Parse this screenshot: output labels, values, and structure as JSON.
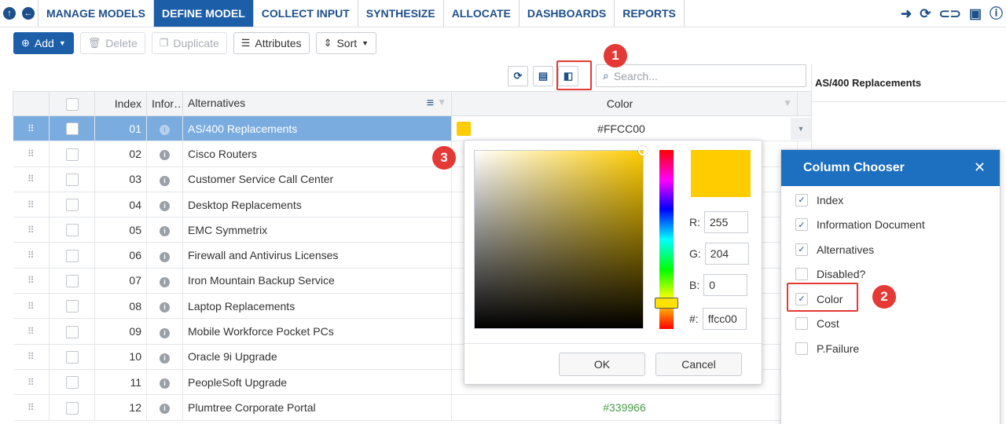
{
  "nav": {
    "tabs": [
      {
        "label": "MANAGE MODELS",
        "active": false
      },
      {
        "label": "DEFINE MODEL",
        "active": true
      },
      {
        "label": "COLLECT INPUT",
        "active": false
      },
      {
        "label": "SYNTHESIZE",
        "active": false
      },
      {
        "label": "ALLOCATE",
        "active": false
      },
      {
        "label": "DASHBOARDS",
        "active": false
      },
      {
        "label": "REPORTS",
        "active": false
      }
    ],
    "icons": [
      "export-icon",
      "refresh-icon",
      "link-icon",
      "camera-icon",
      "info-icon"
    ]
  },
  "toolbar": {
    "add_label": "Add",
    "delete_label": "Delete",
    "duplicate_label": "Duplicate",
    "attributes_label": "Attributes",
    "sort_label": "Sort"
  },
  "search": {
    "placeholder": "Search..."
  },
  "detail": {
    "title": "AS/400 Replacements"
  },
  "table": {
    "headers": {
      "index": "Index",
      "info": "Infor…",
      "alternatives": "Alternatives",
      "color": "Color"
    },
    "rows": [
      {
        "index": "01",
        "name": "AS/400 Replacements",
        "selected": true,
        "color": "#FFCC00",
        "swatch": "#ffcc00"
      },
      {
        "index": "02",
        "name": "Cisco Routers",
        "selected": false,
        "color": "",
        "swatch": ""
      },
      {
        "index": "03",
        "name": "Customer Service Call Center",
        "selected": false,
        "color": "",
        "swatch": ""
      },
      {
        "index": "04",
        "name": "Desktop Replacements",
        "selected": false,
        "color": "",
        "swatch": ""
      },
      {
        "index": "05",
        "name": "EMC Symmetrix",
        "selected": false,
        "color": "",
        "swatch": ""
      },
      {
        "index": "06",
        "name": "Firewall and Antivirus Licenses",
        "selected": false,
        "color": "",
        "swatch": ""
      },
      {
        "index": "07",
        "name": "Iron Mountain Backup Service",
        "selected": false,
        "color": "",
        "swatch": ""
      },
      {
        "index": "08",
        "name": "Laptop Replacements",
        "selected": false,
        "color": "",
        "swatch": ""
      },
      {
        "index": "09",
        "name": "Mobile Workforce Pocket PCs",
        "selected": false,
        "color": "",
        "swatch": ""
      },
      {
        "index": "10",
        "name": "Oracle 9i Upgrade",
        "selected": false,
        "color": "",
        "swatch": ""
      },
      {
        "index": "11",
        "name": "PeopleSoft Upgrade",
        "selected": false,
        "color": "",
        "swatch": ""
      },
      {
        "index": "12",
        "name": "Plumtree Corporate Portal",
        "selected": false,
        "color": "#339966",
        "swatch": ""
      }
    ]
  },
  "picker": {
    "r_label": "R:",
    "r": "255",
    "g_label": "G:",
    "g": "204",
    "b_label": "B:",
    "b": "0",
    "hex_label": "#:",
    "hex": "ffcc00",
    "ok_label": "OK",
    "cancel_label": "Cancel",
    "preview_color": "#ffcc00"
  },
  "chooser": {
    "title": "Column Chooser",
    "close": "✕",
    "items": [
      {
        "label": "Index",
        "checked": true
      },
      {
        "label": "Information Document",
        "checked": true
      },
      {
        "label": "Alternatives",
        "checked": true
      },
      {
        "label": "Disabled?",
        "checked": false
      },
      {
        "label": "Color",
        "checked": true
      },
      {
        "label": "Cost",
        "checked": false
      },
      {
        "label": "P.Failure",
        "checked": false
      }
    ]
  },
  "badges": [
    "1",
    "2",
    "3"
  ],
  "colors": {
    "brand": "#1d4f8a",
    "active_tab": "#1d5ea8",
    "selected_row": "#7aace0",
    "badge": "#e53935"
  }
}
